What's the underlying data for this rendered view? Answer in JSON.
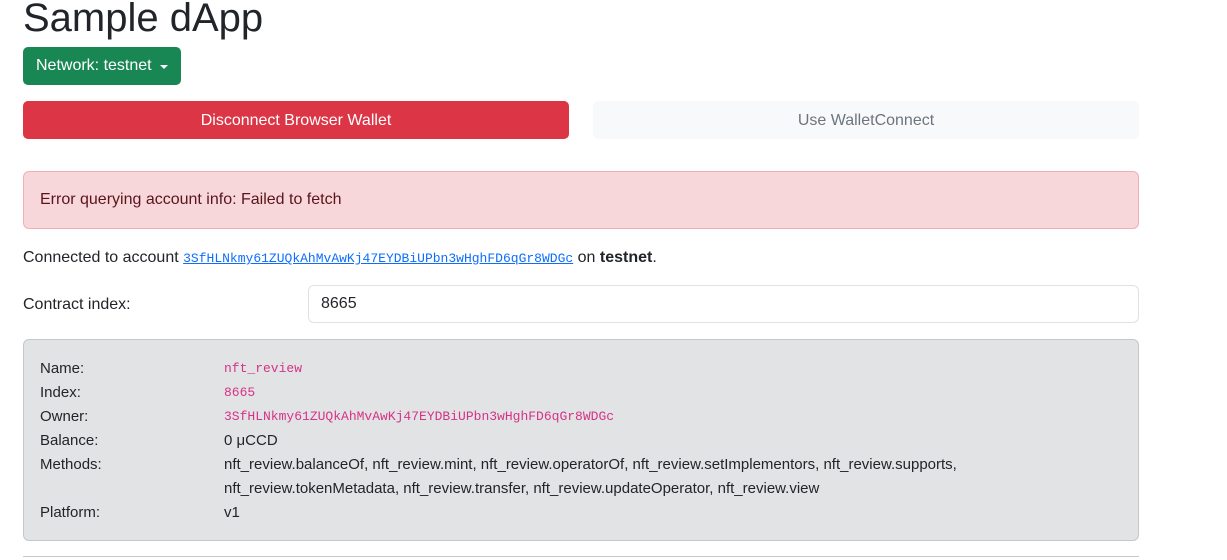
{
  "header": {
    "title": "Sample dApp",
    "network_button_label": "Network: testnet"
  },
  "wallet": {
    "disconnect_label": "Disconnect Browser Wallet",
    "walletconnect_label": "Use WalletConnect"
  },
  "alert": {
    "message": "Error querying account info: Failed to fetch"
  },
  "connection": {
    "prefix": "Connected to account ",
    "account": "3SfHLNkmy61ZUQkAhMvAwKj47EYDBiUPbn3wHghFD6qGr8WDGc",
    "middle": " on ",
    "network": "testnet",
    "suffix": "."
  },
  "contract": {
    "index_label": "Contract index:",
    "index_value": "8665"
  },
  "info": {
    "name_label": "Name:",
    "name_value": "nft_review",
    "index_label": "Index:",
    "index_value": "8665",
    "owner_label": "Owner:",
    "owner_value": "3SfHLNkmy61ZUQkAhMvAwKj47EYDBiUPbn3wHghFD6qGr8WDGc",
    "balance_label": "Balance:",
    "balance_value": "0 μCCD",
    "methods_label": "Methods:",
    "methods_line1": "nft_review.balanceOf, nft_review.mint, nft_review.operatorOf, nft_review.setImplementors, nft_review.supports,",
    "methods_line2": "nft_review.tokenMetadata, nft_review.transfer, nft_review.updateOperator, nft_review.view",
    "platform_label": "Platform:",
    "platform_value": "v1"
  },
  "colors": {
    "success": "#198754",
    "danger": "#dc3545",
    "alert_bg": "#f8d7da",
    "card_bg": "#e2e3e5",
    "code": "#d63384",
    "link": "#0d6efd"
  }
}
